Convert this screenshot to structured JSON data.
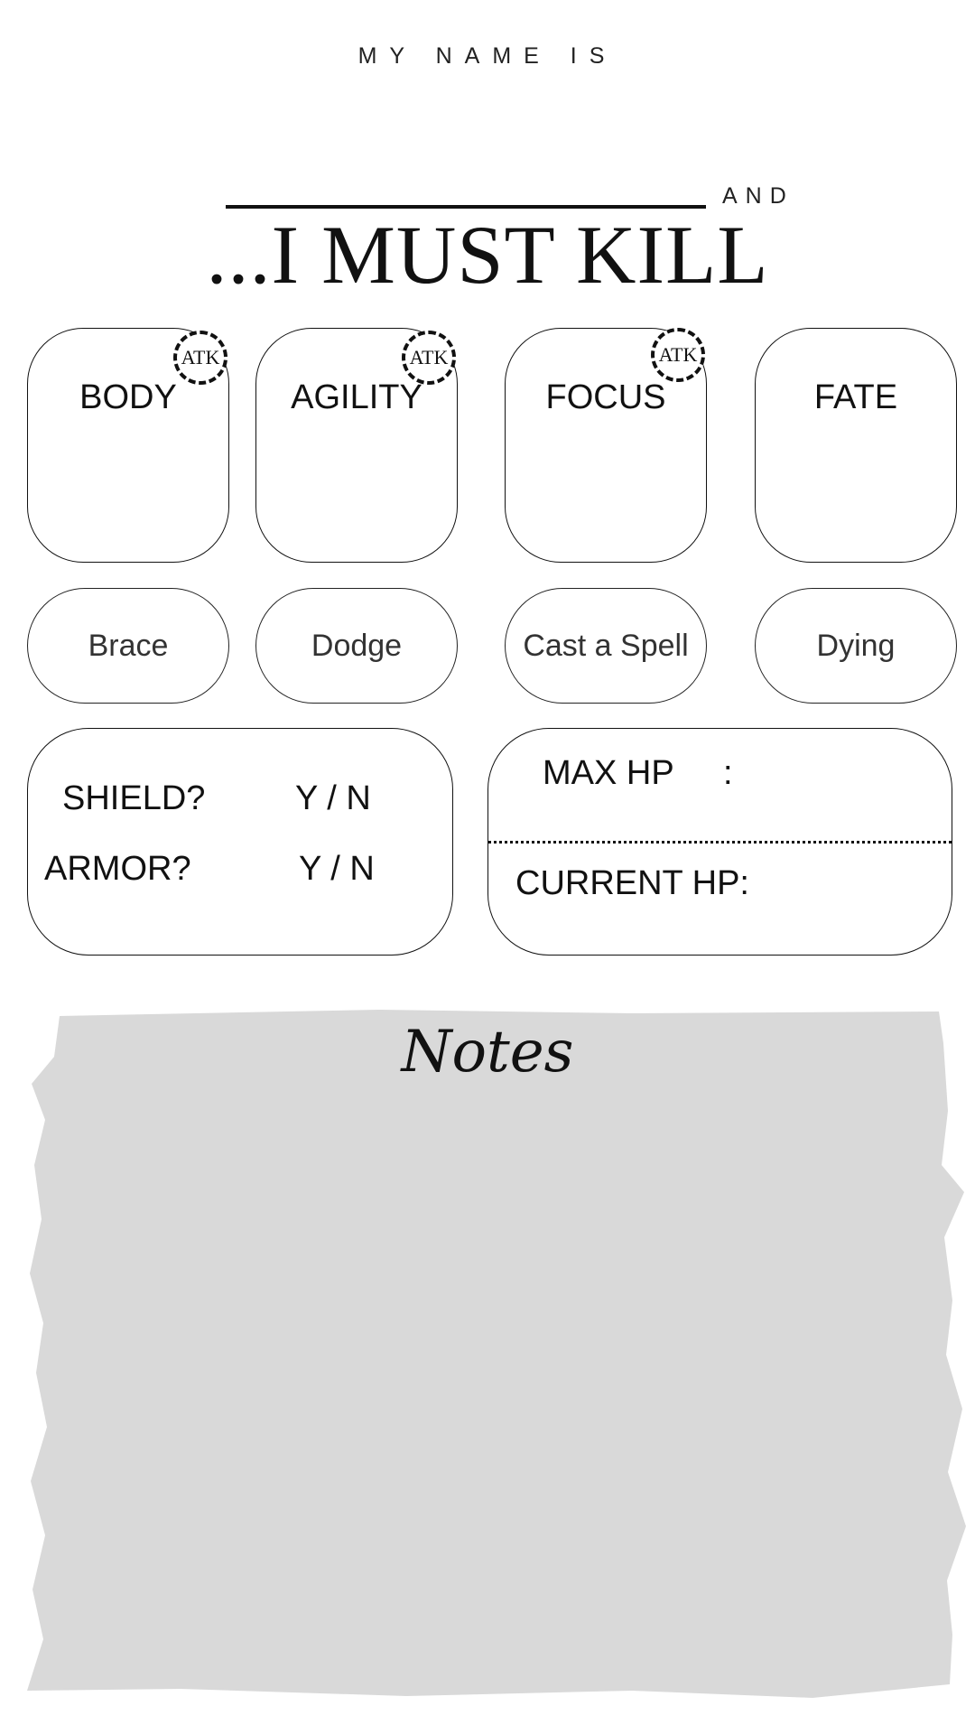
{
  "header": {
    "name_label": "MY NAME IS",
    "and_label": "AND",
    "title": "...I MUST KILL"
  },
  "stats": [
    {
      "label": "BODY",
      "badge": "ATK"
    },
    {
      "label": "AGILITY",
      "badge": "ATK"
    },
    {
      "label": "FOCUS",
      "badge": "ATK"
    },
    {
      "label": "FATE"
    }
  ],
  "actions": [
    "Brace",
    "Dodge",
    "Cast a Spell",
    "Dying"
  ],
  "gear": {
    "shield_label": "SHIELD?",
    "shield_choice": "Y   /   N",
    "armor_label": "ARMOR?",
    "armor_choice": "Y   /   N"
  },
  "hp": {
    "max_label": "MAX HP",
    "max_colon": ":",
    "current_label": "CURRENT HP:"
  },
  "notes": {
    "title": "Notes",
    "fill_color": "#d9d9d9"
  }
}
